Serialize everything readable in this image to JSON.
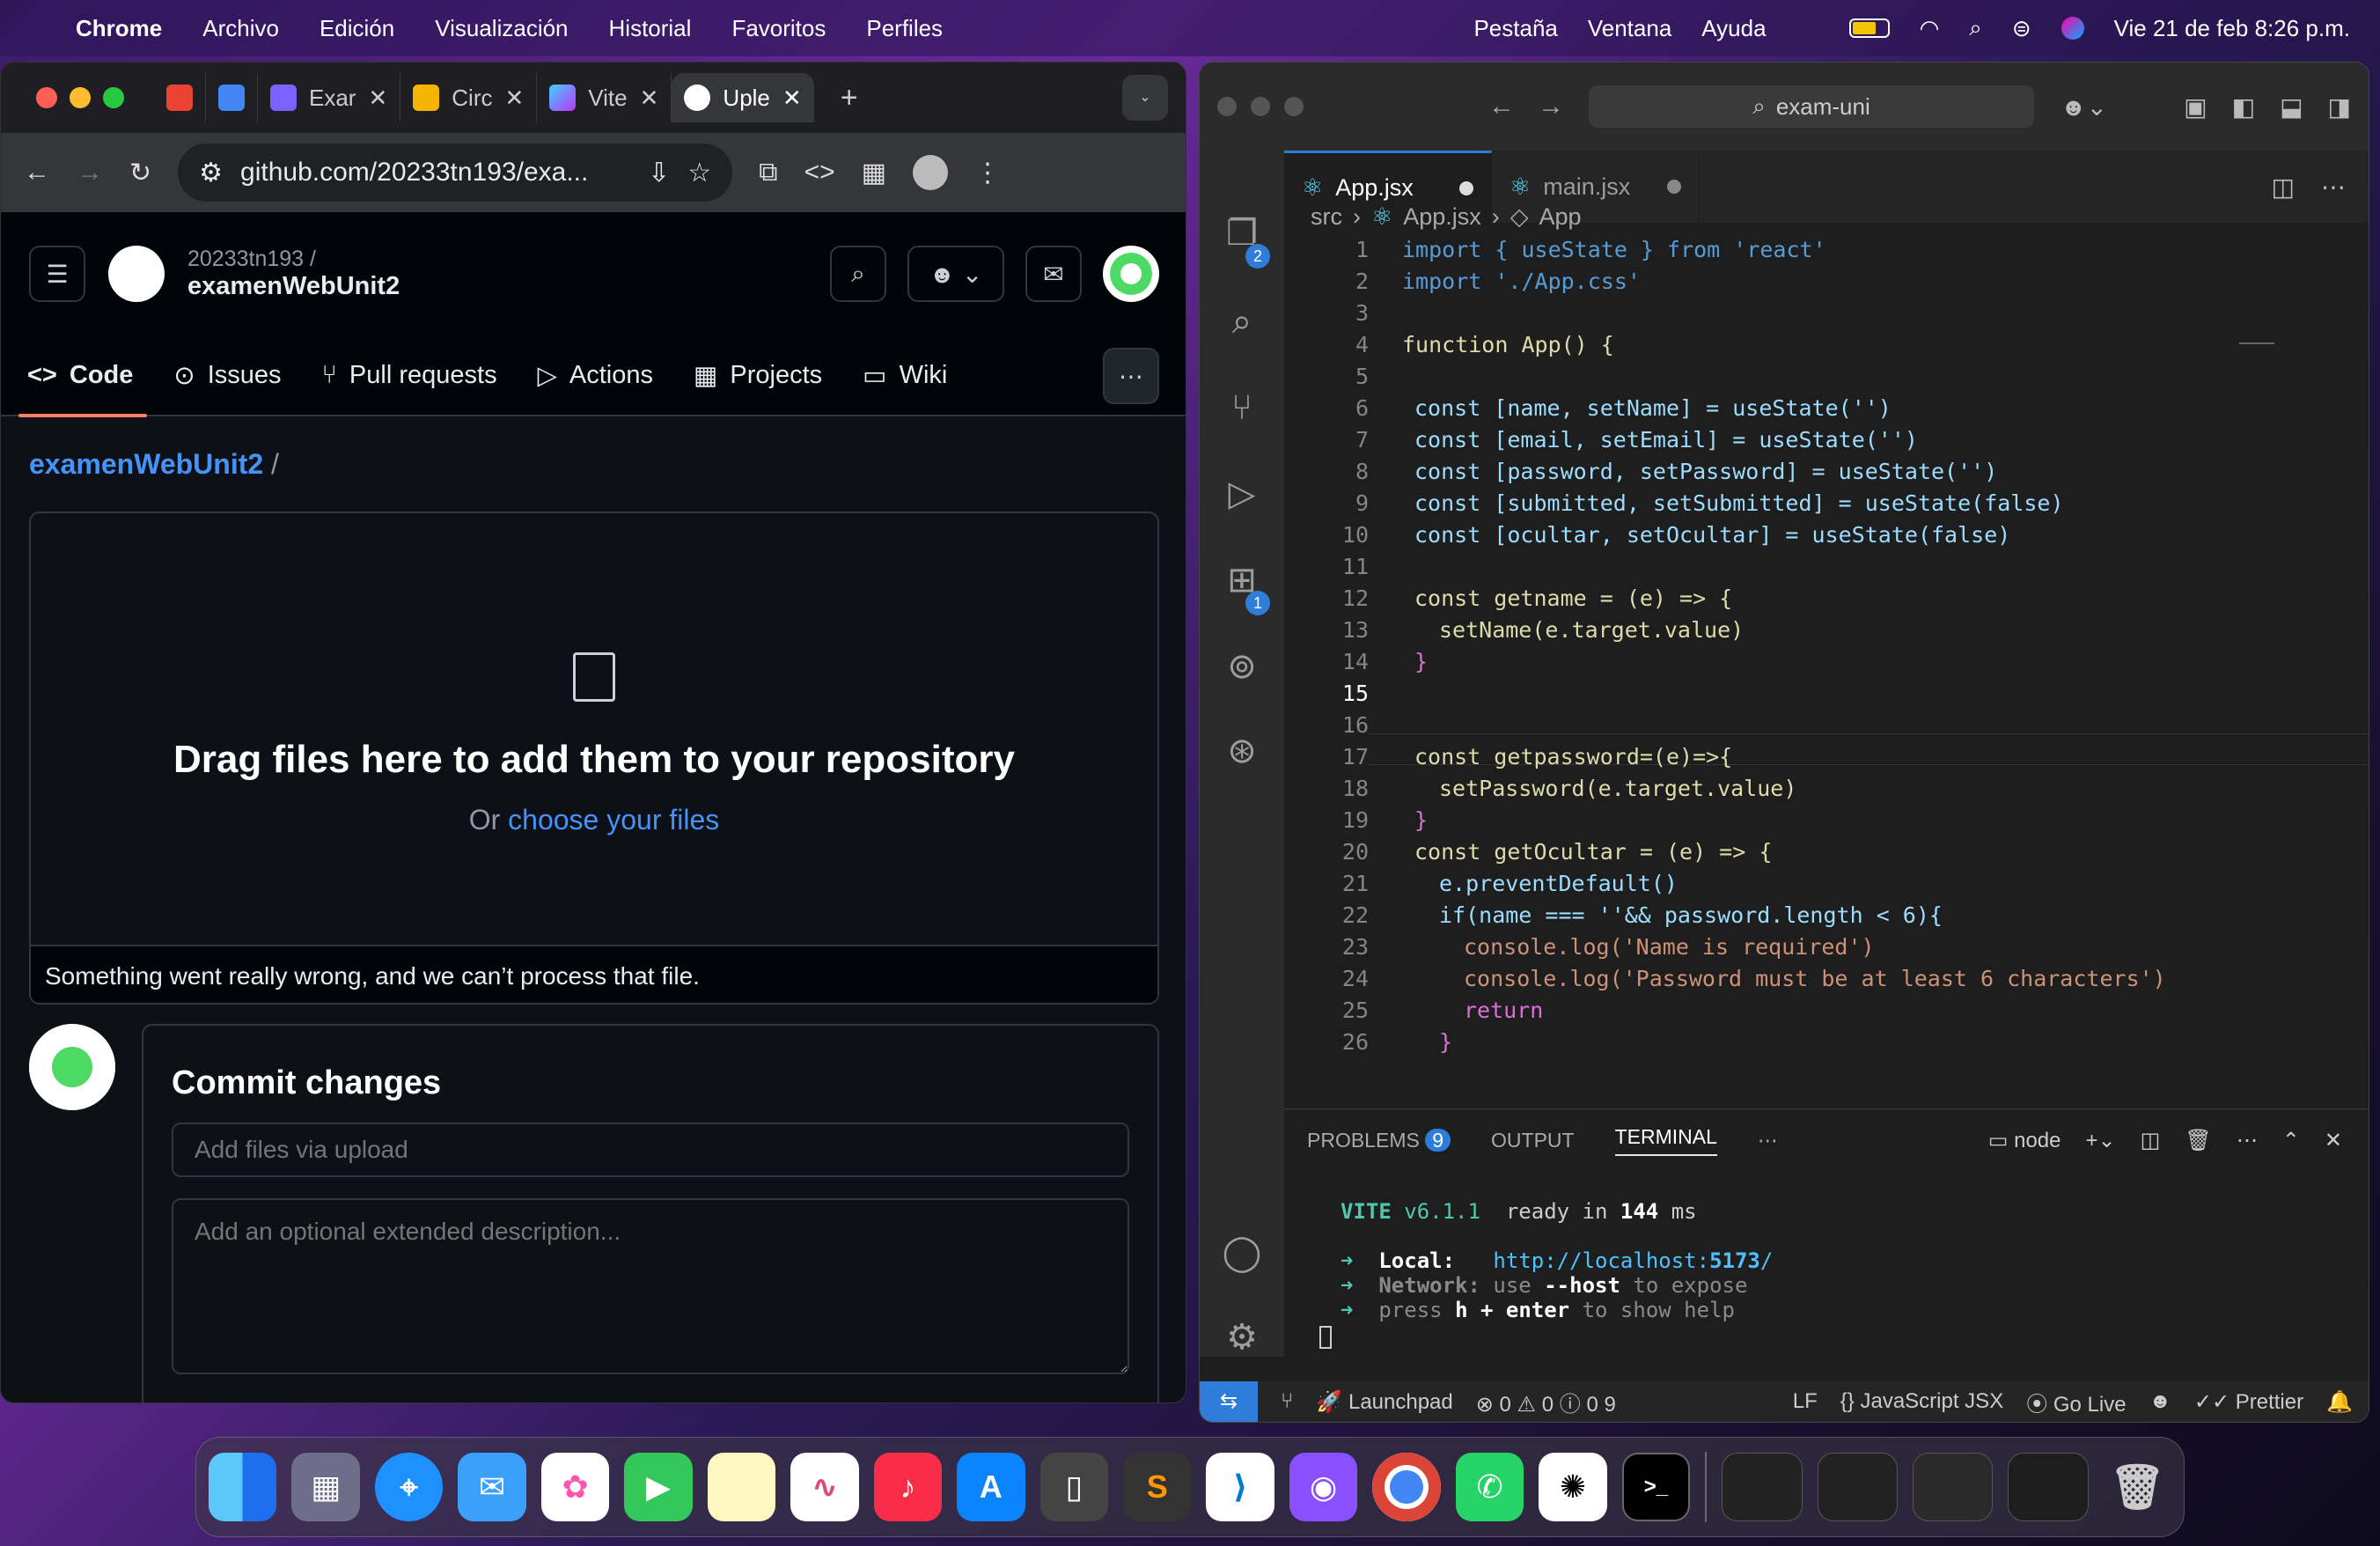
{
  "menubar": {
    "app": "Chrome",
    "items": [
      "Archivo",
      "Edición",
      "Visualización",
      "Historial",
      "Favoritos",
      "Perfiles"
    ],
    "right_items": [
      "Pestaña",
      "Ventana",
      "Ayuda"
    ],
    "datetime": "Vie 21 de feb  8:26 p.m."
  },
  "chrome": {
    "tabs": [
      {
        "label": "",
        "color": "#ea4335"
      },
      {
        "label": "",
        "color": "#4285f4"
      },
      {
        "label": "Exar",
        "color": "#7b61ff"
      },
      {
        "label": "Circ",
        "color": "#f4b400"
      },
      {
        "label": "Vite",
        "color": "#a855f7"
      },
      {
        "label": "Uple",
        "color": "#ffffff"
      }
    ],
    "url": "github.com/20233tn193/exa..."
  },
  "github": {
    "owner": "20233tn193 /",
    "repo": "examenWebUnit2",
    "nav": [
      "Code",
      "Issues",
      "Pull requests",
      "Actions",
      "Projects",
      "Wiki"
    ],
    "breadcrumb_repo": "examenWebUnit2",
    "breadcrumb_sep": "/",
    "drop_title": "Drag files here to add them to your repository",
    "drop_or": "Or",
    "drop_link": "choose your files",
    "error": "Something went really wrong, and we can’t process that file.",
    "commit_title": "Commit changes",
    "commit_placeholder": "Add files via upload",
    "desc_placeholder": "Add an optional extended description..."
  },
  "vscode": {
    "search": "exam-uni",
    "tabs": [
      {
        "label": "App.jsx"
      },
      {
        "label": "main.jsx"
      }
    ],
    "breadcrumb": [
      "src",
      "App.jsx",
      "App"
    ],
    "explorer_badge": "2",
    "extensions_badge": "1",
    "line_numbers": [
      "1",
      "2",
      "3",
      "4",
      "5",
      "6",
      "7",
      "8",
      "9",
      "10",
      "11",
      "12",
      "13",
      "14",
      "15",
      "16",
      "17",
      "18",
      "19",
      "20",
      "21",
      "22",
      "23",
      "24",
      "25",
      "26"
    ],
    "panel_tabs": [
      "PROBLEMS",
      "OUTPUT",
      "TERMINAL"
    ],
    "problems_count": "9",
    "terminal_shell": "node",
    "terminal": {
      "vite": "VITE",
      "version": "v6.1.1",
      "ready": "ready in",
      "ms": "144",
      "ms_unit": "ms",
      "local_label": "Local:",
      "local_url_a": "http://localhost:",
      "local_port": "5173",
      "local_url_b": "/",
      "network_label": "Network:",
      "network_text_a": "use",
      "network_flag": "--host",
      "network_text_b": "to expose",
      "help_a": "press",
      "help_h": "h",
      "help_plus": "+",
      "help_enter": "enter",
      "help_b": "to show help"
    },
    "status": {
      "launchpad": "Launchpad",
      "errors": "0",
      "warnings": "0",
      "infos": "0",
      "other": "9",
      "eol": "LF",
      "language": "JavaScript JSX",
      "golive": "Go Live",
      "prettier": "Prettier"
    }
  },
  "code_lines": [
    "import { useState } from 'react'",
    "import './App.css'",
    "",
    "function App() {",
    "",
    "const [name, setName] = useState('')",
    "const [email, setEmail] = useState('')",
    "const [password, setPassword] = useState('')",
    "const [submitted, setSubmitted] = useState(false)",
    "const [ocultar, setOcultar] = useState(false)",
    "",
    "const getname = (e) => {",
    "setName(e.target.value)",
    "}",
    "",
    "",
    "const getpassword=(e)=>{",
    "setPassword(e.target.value)",
    "}",
    "const getOcultar = (e) => {",
    "e.preventDefault()",
    "if(name === ''&& password.length < 6){",
    "console.log('Name is required')",
    "console.log('Password must be at least 6 characters')",
    "return",
    "}"
  ]
}
